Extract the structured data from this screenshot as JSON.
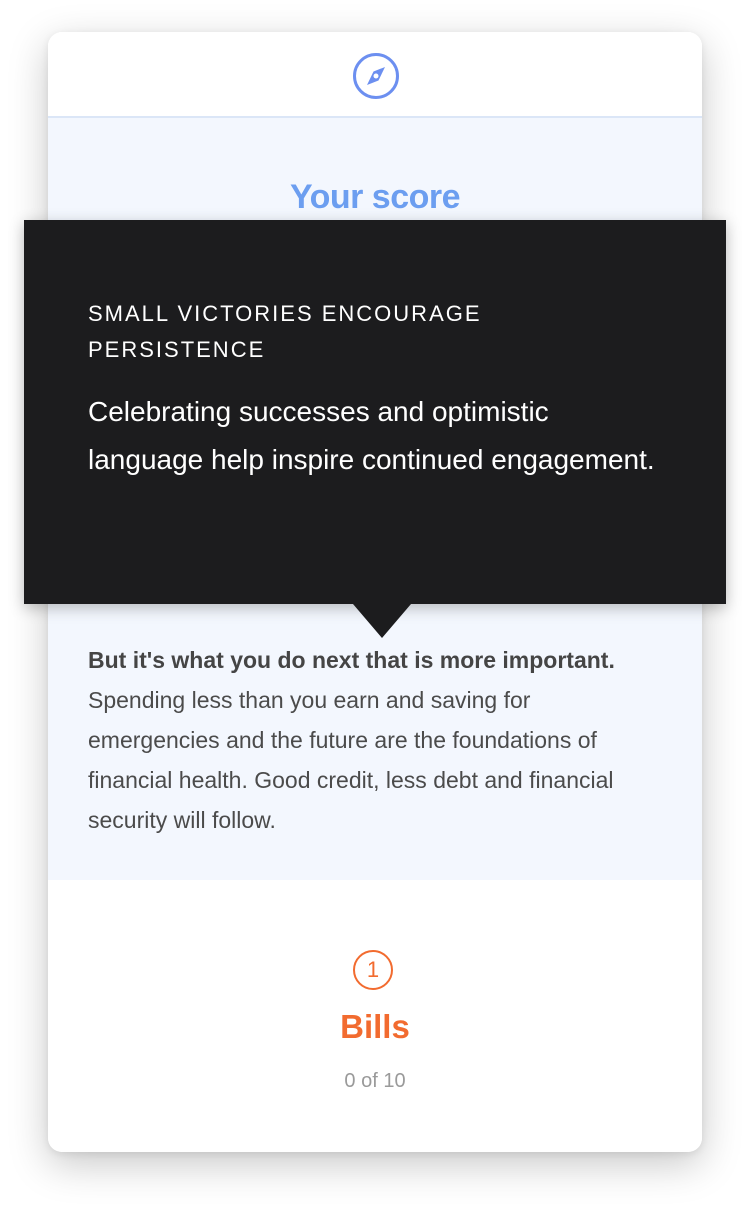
{
  "header": {
    "icon": "compass-icon",
    "accent_color": "#6c8ff0"
  },
  "score": {
    "title": "Your score"
  },
  "advice": {
    "bold": "But it's what you do next that is more important.",
    "text": " Spending less than you earn and saving for emergencies and the future are the foundations of financial health. Good credit, less debt and financial security will follow."
  },
  "bills": {
    "step": "1",
    "title": "Bills",
    "progress": "0 of 10",
    "color": "#f26b2f"
  },
  "tooltip": {
    "heading": "SMALL VICTORIES ENCOURAGE PERSISTENCE",
    "body": "Celebrating successes and optimistic language help inspire continued engagement."
  }
}
